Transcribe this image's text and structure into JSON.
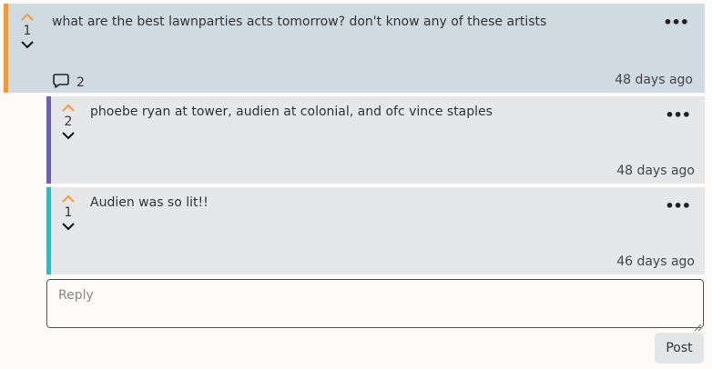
{
  "post": {
    "score": "1",
    "body": "what are the best lawnparties acts tomorrow? don't know any of these artists",
    "comment_count": "2",
    "timestamp": "48 days ago",
    "menu": "•••"
  },
  "replies": [
    {
      "score": "2",
      "body": "phoebe ryan at tower, audien at colonial, and ofc vince staples",
      "timestamp": "48 days ago",
      "menu": "•••"
    },
    {
      "score": "1",
      "body": "Audien was so lit!!",
      "timestamp": "46 days ago",
      "menu": "•••"
    }
  ],
  "reply_form": {
    "placeholder": "Reply",
    "post_label": "Post"
  },
  "colors": {
    "upvote": "#f09a3e",
    "post_accent": "#f09a3e",
    "reply_1_accent": "#6a5fc1",
    "reply_2_accent": "#17c3cf"
  },
  "icons": {
    "upvote": "chevron-up-icon",
    "downvote": "chevron-down-icon",
    "comments": "speech-bubble-icon",
    "menu": "ellipsis-icon"
  }
}
